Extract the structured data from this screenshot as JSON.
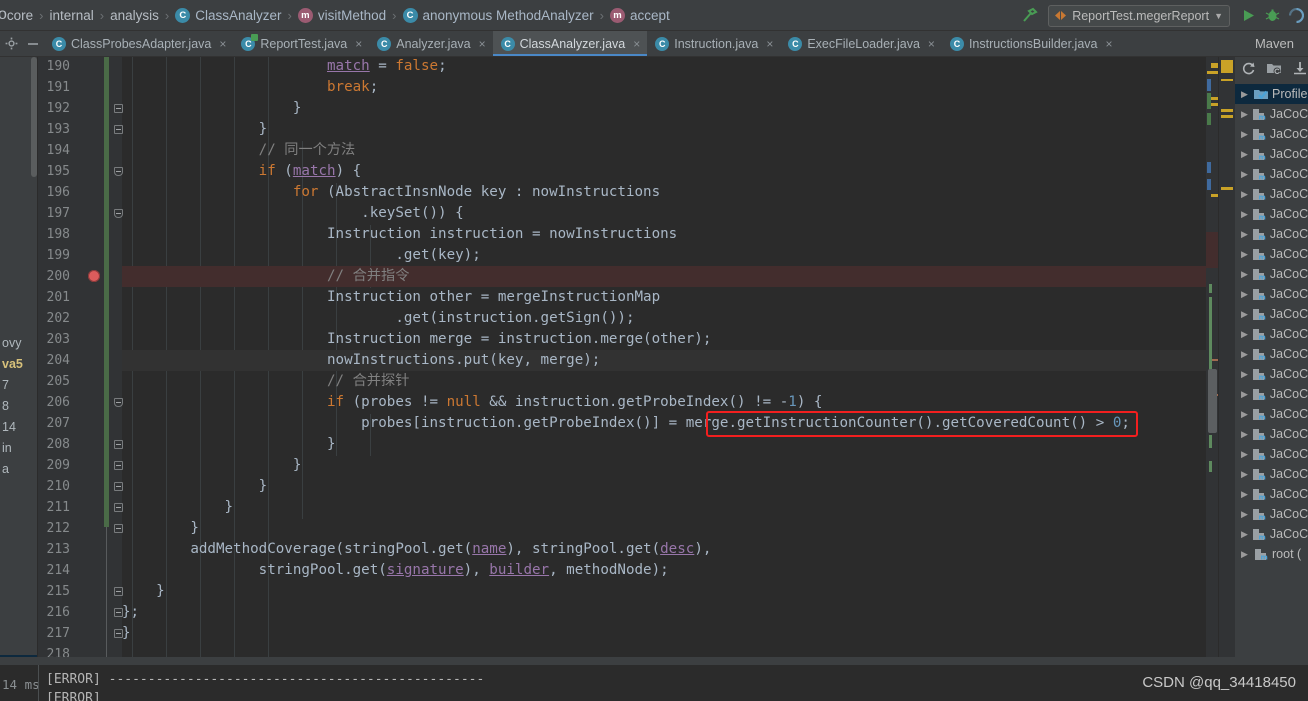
{
  "breadcrumb": {
    "items": [
      {
        "label": "core",
        "icon": "none"
      },
      {
        "label": "internal",
        "icon": "none"
      },
      {
        "label": "analysis",
        "icon": "none"
      },
      {
        "label": "ClassAnalyzer",
        "icon": "class-icon",
        "badge": "C"
      },
      {
        "label": "visitMethod",
        "icon": "method-icon",
        "badge": "m"
      },
      {
        "label": "anonymous MethodAnalyzer",
        "icon": "anonymous-class-icon",
        "badge": "C"
      },
      {
        "label": "accept",
        "icon": "method-icon",
        "badge": "m"
      }
    ],
    "separator": "›"
  },
  "toolbar": {
    "hammer_icon": "build-hammer-icon",
    "run_config": "ReportTest.megerReport",
    "run_config_caret": "▼",
    "run_icon": "run-icon",
    "debug_icon": "debug-icon",
    "coverage_icon": "coverage-icon"
  },
  "tabs": {
    "settings_icon": "gear-icon",
    "collapse_icon": "minimize-icon",
    "items": [
      {
        "label": "ClassProbesAdapter.java",
        "badge": "C",
        "active": false,
        "modified": false
      },
      {
        "label": "ReportTest.java",
        "badge": "C",
        "active": false,
        "modified": true
      },
      {
        "label": "Analyzer.java",
        "badge": "C",
        "active": false,
        "modified": false
      },
      {
        "label": "ClassAnalyzer.java",
        "badge": "C",
        "active": true,
        "modified": false
      },
      {
        "label": "Instruction.java",
        "badge": "C",
        "active": false,
        "modified": false
      },
      {
        "label": "ExecFileLoader.java",
        "badge": "C",
        "active": false,
        "modified": false
      },
      {
        "label": "InstructionsBuilder.java",
        "badge": "C",
        "active": false,
        "modified": false
      }
    ],
    "close_glyph": "×",
    "right_label": "Maven"
  },
  "left_strip": {
    "items": [
      "ovy",
      "va5",
      "7",
      "8",
      "14",
      "in",
      "a"
    ]
  },
  "editor": {
    "first_line": 190,
    "breakpoint_line": 200,
    "current_line": 204,
    "lines": [
      {
        "n": 190,
        "html": "                        <span class='fld und'>match</span> = <span class='kw'>false</span>;",
        "fold": null
      },
      {
        "n": 191,
        "html": "                        <span class='kw'>break</span>;",
        "fold": null
      },
      {
        "n": 192,
        "html": "                    }",
        "fold": "arrow-up"
      },
      {
        "n": 193,
        "html": "                }",
        "fold": "arrow-up"
      },
      {
        "n": 194,
        "html": "                <span class='cm'>// 同一个方法</span>",
        "fold": null
      },
      {
        "n": 195,
        "html": "                <span class='kw'>if</span> (<span class='fld und'>match</span>) {",
        "fold": "arrow-down"
      },
      {
        "n": 196,
        "html": "                    <span class='kw'>for</span> (AbstractInsnNode key : nowInstructions",
        "fold": null
      },
      {
        "n": 197,
        "html": "                            .keySet()) {",
        "fold": "arrow-down"
      },
      {
        "n": 198,
        "html": "                        Instruction instruction = nowInstructions",
        "fold": null
      },
      {
        "n": 199,
        "html": "                                .get(key);",
        "fold": null
      },
      {
        "n": 200,
        "html": "                        <span class='cm'>// 合并指令</span>",
        "fold": null
      },
      {
        "n": 201,
        "html": "                        Instruction other = mergeInstructionMap",
        "fold": null
      },
      {
        "n": 202,
        "html": "                                .get(instruction.getSign());",
        "fold": null
      },
      {
        "n": 203,
        "html": "                        Instruction merge = instruction.merge(other);",
        "fold": null
      },
      {
        "n": 204,
        "html": "                        nowInstructions.put(key, merge);",
        "fold": null
      },
      {
        "n": 205,
        "html": "                        <span class='cm'>// 合并探针</span>",
        "fold": null
      },
      {
        "n": 206,
        "html": "                        <span class='kw'>if</span> (probes != <span class='kw'>null</span> &amp;&amp; instruction.getProbeIndex() != -<span class='num'>1</span>) {",
        "fold": "arrow-down"
      },
      {
        "n": 207,
        "html": "                            probes[instruction.getProbeIndex()] = merge.getInstructionCounter().getCoveredCount() &gt; <span class='num'>0</span>;",
        "fold": null
      },
      {
        "n": 208,
        "html": "                        }",
        "fold": "arrow-up"
      },
      {
        "n": 209,
        "html": "                    }",
        "fold": "arrow-up"
      },
      {
        "n": 210,
        "html": "                }",
        "fold": "arrow-up"
      },
      {
        "n": 211,
        "html": "            }",
        "fold": "arrow-up"
      },
      {
        "n": 212,
        "html": "        }",
        "fold": "arrow-up"
      },
      {
        "n": 213,
        "html": "        addMethodCoverage(stringPool.get(<span class='fld und'>name</span>), stringPool.get(<span class='fld und'>desc</span>),",
        "fold": null
      },
      {
        "n": 214,
        "html": "                stringPool.get(<span class='fld und'>signature</span>), <span class='fld und'>builder</span>, methodNode);",
        "fold": null
      },
      {
        "n": 215,
        "html": "    }",
        "fold": "arrow-up"
      },
      {
        "n": 216,
        "html": "};",
        "fold": "arrow-up"
      },
      {
        "n": 217,
        "html": "}",
        "fold": "arrow-up"
      },
      {
        "n": 218,
        "html": "",
        "fold": null
      }
    ],
    "highlight_box_text": "merge.getInstructionCounter().getCoveredCount() > 0;"
  },
  "maven": {
    "toolbar_icons": [
      "refresh-icon",
      "folder-refresh-icon",
      "download-icon"
    ],
    "rows": [
      {
        "label": "Profile",
        "icon": "profiles-icon",
        "selected": true
      },
      {
        "label": "JaCoC",
        "icon": "maven-goal-icon",
        "selected": false
      },
      {
        "label": "JaCoC",
        "icon": "maven-goal-icon",
        "selected": false
      },
      {
        "label": "JaCoC",
        "icon": "maven-goal-icon",
        "selected": false
      },
      {
        "label": "JaCoC",
        "icon": "maven-goal-icon",
        "selected": false
      },
      {
        "label": "JaCoC",
        "icon": "maven-goal-icon",
        "selected": false
      },
      {
        "label": "JaCoC",
        "icon": "maven-goal-icon",
        "selected": false
      },
      {
        "label": "JaCoC",
        "icon": "maven-goal-icon",
        "selected": false
      },
      {
        "label": "JaCoC",
        "icon": "maven-goal-icon",
        "selected": false
      },
      {
        "label": "JaCoC",
        "icon": "maven-goal-icon",
        "selected": false
      },
      {
        "label": "JaCoC",
        "icon": "maven-goal-icon",
        "selected": false
      },
      {
        "label": "JaCoC",
        "icon": "maven-goal-icon",
        "selected": false
      },
      {
        "label": "JaCoC",
        "icon": "maven-goal-icon",
        "selected": false
      },
      {
        "label": "JaCoC",
        "icon": "maven-goal-icon",
        "selected": false
      },
      {
        "label": "JaCoC",
        "icon": "maven-goal-icon",
        "selected": false
      },
      {
        "label": "JaCoC",
        "icon": "maven-goal-icon",
        "selected": false
      },
      {
        "label": "JaCoC",
        "icon": "maven-goal-icon",
        "selected": false
      },
      {
        "label": "JaCoC",
        "icon": "maven-goal-icon",
        "selected": false
      },
      {
        "label": "JaCoC",
        "icon": "maven-goal-icon",
        "selected": false
      },
      {
        "label": "JaCoC",
        "icon": "maven-goal-icon",
        "selected": false
      },
      {
        "label": "JaCoC",
        "icon": "maven-goal-icon",
        "selected": false
      },
      {
        "label": "JaCoC",
        "icon": "maven-goal-icon",
        "selected": false
      },
      {
        "label": "JaCoC",
        "icon": "maven-goal-icon",
        "selected": false
      },
      {
        "label": "root (",
        "icon": "maven-goal-icon",
        "selected": false
      }
    ],
    "arrow_glyph": "▶"
  },
  "console": {
    "elapsed": "14 ms",
    "line1": "[ERROR] ------------------------------------------------",
    "line2": "[ERROR]"
  },
  "watermark": "CSDN @qq_34418450",
  "colors": {
    "accent": "#4a88c7",
    "breakpoint": "#db5c5c",
    "highlight_box": "#f21f1f",
    "editor_bg": "#2b2b2b",
    "chrome_bg": "#3c3f41"
  }
}
